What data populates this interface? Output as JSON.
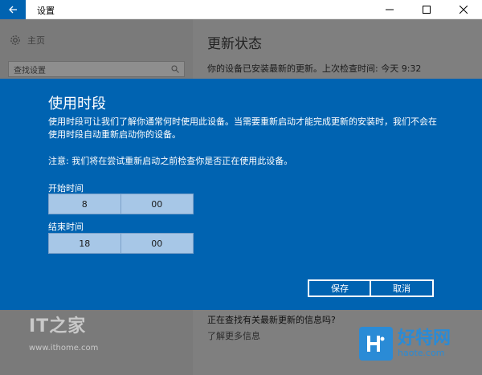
{
  "window": {
    "title": "设置",
    "back_icon": "arrow-left-icon",
    "minimize_icon": "minimize-icon",
    "maximize_icon": "maximize-icon",
    "close_icon": "close-icon"
  },
  "sidebar": {
    "home_label": "主页",
    "search_placeholder": "查找设置"
  },
  "main": {
    "heading": "更新状态",
    "status_text": "你的设备已安装最新的更新。上次检查时间: 今天 9:32",
    "question": "正在查找有关最新更新的信息吗?",
    "learn_more": "了解更多信息"
  },
  "dialog": {
    "title": "使用时段",
    "description": "使用时段可让我们了解你通常何时使用此设备。当需要重新启动才能完成更新的安装时，我们不会在使用时段自动重新启动你的设备。",
    "note": "注意: 我们将在尝试重新启动之前检查你是否正在使用此设备。",
    "start_label": "开始时间",
    "start_hour": "8",
    "start_minute": "00",
    "end_label": "结束时间",
    "end_hour": "18",
    "end_minute": "00",
    "save_label": "保存",
    "cancel_label": "取消"
  },
  "watermarks": {
    "ithome_text": "IT之家",
    "ithome_url": "www.ithome.com",
    "haote_main": "好特网",
    "haote_sub": "haote.com"
  },
  "colors": {
    "accent": "#0063b1",
    "picker": "#a7c7e7",
    "dim_overlay": "#7f7f7f"
  }
}
